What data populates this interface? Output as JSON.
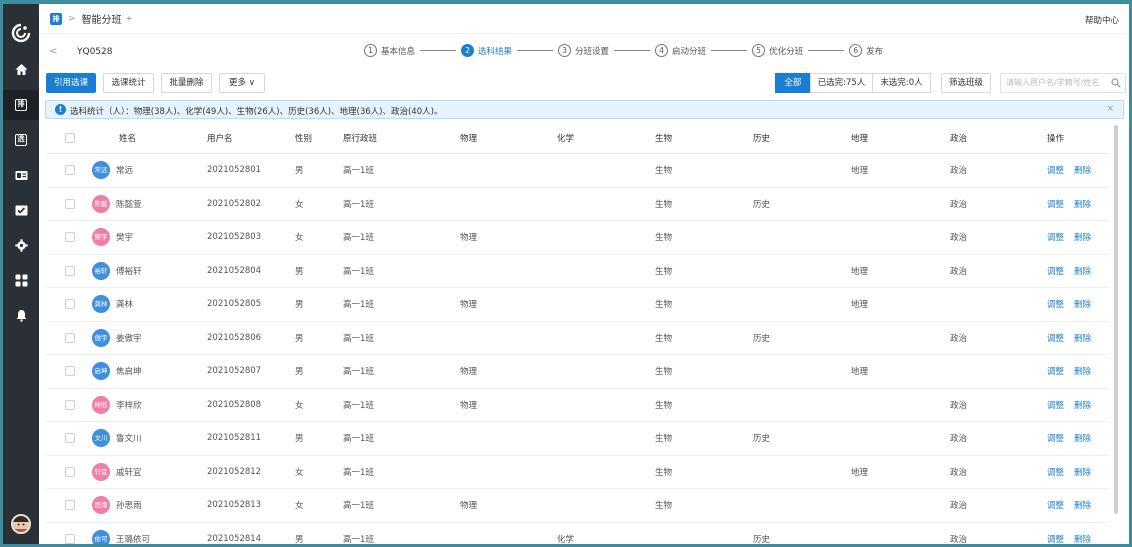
{
  "app": {
    "breadcrumb_badge": "排",
    "breadcrumb_sep": ">",
    "title": "智能分班",
    "title_caret": "÷",
    "help": "帮助中心"
  },
  "stepbar": {
    "back": "<",
    "class_code": "YQ0528",
    "steps": [
      {
        "num": "1",
        "label": "基本信息",
        "active": false
      },
      {
        "num": "2",
        "label": "选科结果",
        "active": true
      },
      {
        "num": "3",
        "label": "分班设置",
        "active": false
      },
      {
        "num": "4",
        "label": "启动分班",
        "active": false
      },
      {
        "num": "5",
        "label": "优化分班",
        "active": false
      },
      {
        "num": "6",
        "label": "发布",
        "active": false
      }
    ]
  },
  "toolbar": {
    "cite_label": "引用选课",
    "stats_label": "选课统计",
    "batch_delete_label": "批量删除",
    "more_label": "更多 ∨",
    "filter_all": "全部",
    "filter_selected": "已选完:75人",
    "filter_unselected": "未选完:0人",
    "filter_class": "筛选班级",
    "search_placeholder": "请输入用户名/学籍号/姓名"
  },
  "alert": {
    "icon": "!",
    "text": "选科统计（人）：物理(38人)、化学(49人)、生物(26人)、历史(36人)、地理(36人)、政治(40人)。",
    "close": "×"
  },
  "table": {
    "headers": {
      "name": "姓名",
      "username": "用户名",
      "gender": "性别",
      "class": "原行政班",
      "physics": "物理",
      "chemistry": "化学",
      "biology": "生物",
      "history": "历史",
      "geography": "地理",
      "politics": "政治",
      "ops": "操作"
    },
    "op_adjust": "调整",
    "op_delete": "删除",
    "rows": [
      {
        "avatar": "常远",
        "avatar_color": "#3f8fe0",
        "name": "常远",
        "username": "2021052801",
        "gender": "男",
        "class": "高一1班",
        "physics": "",
        "chemistry": "",
        "biology": "生物",
        "history": "",
        "geography": "地理",
        "politics": "政治"
      },
      {
        "avatar": "陈懿",
        "avatar_color": "#ef7fa6",
        "name": "陈懿萱",
        "username": "2021052802",
        "gender": "女",
        "class": "高一1班",
        "physics": "",
        "chemistry": "",
        "biology": "生物",
        "history": "历史",
        "geography": "",
        "politics": "政治"
      },
      {
        "avatar": "樊宇",
        "avatar_color": "#ef7fa6",
        "name": "樊宇",
        "username": "2021052803",
        "gender": "女",
        "class": "高一1班",
        "physics": "物理",
        "chemistry": "",
        "biology": "生物",
        "history": "",
        "geography": "",
        "politics": "政治"
      },
      {
        "avatar": "裕轩",
        "avatar_color": "#3f8fe0",
        "name": "傅裕轩",
        "username": "2021052804",
        "gender": "男",
        "class": "高一1班",
        "physics": "",
        "chemistry": "",
        "biology": "生物",
        "history": "",
        "geography": "地理",
        "politics": "政治"
      },
      {
        "avatar": "龚林",
        "avatar_color": "#3f8fe0",
        "name": "龚林",
        "username": "2021052805",
        "gender": "男",
        "class": "高一1班",
        "physics": "物理",
        "chemistry": "",
        "biology": "生物",
        "history": "",
        "geography": "地理",
        "politics": ""
      },
      {
        "avatar": "傲宇",
        "avatar_color": "#3f8fe0",
        "name": "姜傲宇",
        "username": "2021052806",
        "gender": "男",
        "class": "高一1班",
        "physics": "",
        "chemistry": "",
        "biology": "生物",
        "history": "历史",
        "geography": "",
        "politics": "政治"
      },
      {
        "avatar": "启坤",
        "avatar_color": "#3f8fe0",
        "name": "焦启坤",
        "username": "2021052807",
        "gender": "男",
        "class": "高一1班",
        "physics": "物理",
        "chemistry": "",
        "biology": "生物",
        "history": "",
        "geography": "地理",
        "politics": ""
      },
      {
        "avatar": "梓欣",
        "avatar_color": "#ef7fa6",
        "name": "李梓欣",
        "username": "2021052808",
        "gender": "女",
        "class": "高一1班",
        "physics": "物理",
        "chemistry": "",
        "biology": "生物",
        "history": "",
        "geography": "",
        "politics": "政治"
      },
      {
        "avatar": "文川",
        "avatar_color": "#3f8fe0",
        "name": "鲁文川",
        "username": "2021052811",
        "gender": "男",
        "class": "高一1班",
        "physics": "",
        "chemistry": "",
        "biology": "生物",
        "history": "历史",
        "geography": "",
        "politics": "政治"
      },
      {
        "avatar": "轩宜",
        "avatar_color": "#ef7fa6",
        "name": "戚轩宜",
        "username": "2021052812",
        "gender": "女",
        "class": "高一1班",
        "physics": "",
        "chemistry": "",
        "biology": "生物",
        "history": "",
        "geography": "地理",
        "politics": "政治"
      },
      {
        "avatar": "思雨",
        "avatar_color": "#ef7fa6",
        "name": "孙思雨",
        "username": "2021052813",
        "gender": "女",
        "class": "高一1班",
        "physics": "物理",
        "chemistry": "",
        "biology": "生物",
        "history": "",
        "geography": "",
        "politics": "政治"
      },
      {
        "avatar": "依可",
        "avatar_color": "#3f8fe0",
        "name": "王璐依可",
        "username": "2021052814",
        "gender": "男",
        "class": "高一1班",
        "physics": "",
        "chemistry": "化学",
        "biology": "",
        "history": "历史",
        "geography": "",
        "politics": "政治"
      }
    ]
  },
  "colors": {
    "accent": "#1a7fd4",
    "sidebar": "#2b2f36",
    "alert_bg": "#e6f3fc",
    "avatar_male": "#3f8fe0",
    "avatar_female": "#ef7fa6"
  }
}
